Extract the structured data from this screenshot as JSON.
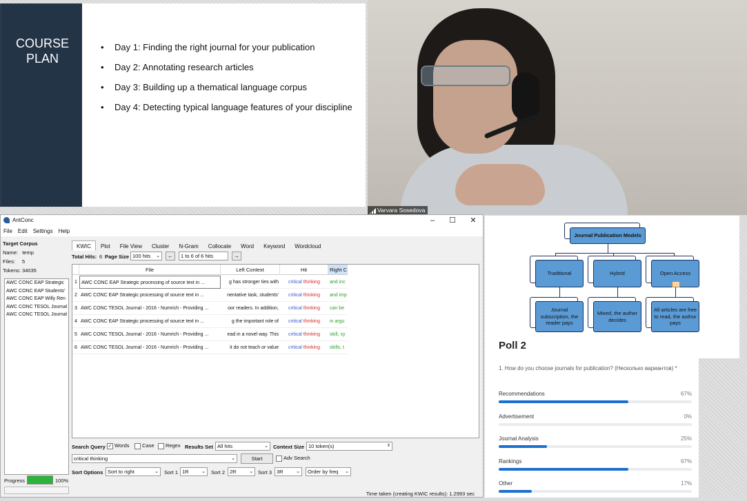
{
  "slide": {
    "title_line1": "COURSE",
    "title_line2": "PLAN",
    "items": [
      "Day 1: Finding the right journal for your publication",
      "Day 2: Annotating research articles",
      "Day 3: Building up a thematical language corpus",
      "Day 4: Detecting typical language features of your discipline"
    ]
  },
  "webcam": {
    "participant_name": "Varvara Sosedova"
  },
  "antconc": {
    "title": "AntConc",
    "window_controls": {
      "minimize": "–",
      "maximize": "☐",
      "close": "✕"
    },
    "menu": [
      "File",
      "Edit",
      "Settings",
      "Help"
    ],
    "target_corpus_label": "Target Corpus",
    "name_label": "Name:",
    "name_value": "temp",
    "files_label": "Files:",
    "files_value": "5",
    "tokens_label": "Tokens:",
    "tokens_value": "34035",
    "corpus_files": [
      "AWC CONC EAP Strategic",
      "AWC CONC EAP Students'",
      "AWC CONC EAP Willy Ren",
      "AWC CONC TESOL Journal",
      "AWC CONC TESOL Journal"
    ],
    "progress_label": "Progress",
    "progress_value": "100%",
    "tabs": [
      "KWIC",
      "Plot",
      "File View",
      "Cluster",
      "N-Gram",
      "Collocate",
      "Word",
      "Keyword",
      "Wordcloud"
    ],
    "total_hits_label": "Total Hits:",
    "total_hits_value": "6",
    "page_size_label": "Page Size",
    "page_size_value": "100 hits",
    "page_range": "1 to 6 of 6 hits",
    "columns": {
      "file": "File",
      "left": "Left Context",
      "hit": "Hit",
      "right": "Right Context"
    },
    "rows": [
      {
        "n": "1",
        "file": "AWC CONC EAP Strategic processing of source text in ...",
        "left": "g has stronger ties with",
        "hit1": "critical",
        "hit2": "thinking",
        "right": "and inc"
      },
      {
        "n": "2",
        "file": "AWC CONC EAP Strategic processing of source text in ...",
        "left": "nentative task, students'",
        "hit1": "critical",
        "hit2": "thinking",
        "right": "and imp"
      },
      {
        "n": "3",
        "file": "AWC CONC TESOL Journal - 2016 - Numrich - Providing ...",
        "left": "oor readers. In addition,",
        "hit1": "critical",
        "hit2": "thinking",
        "right": "can be"
      },
      {
        "n": "4",
        "file": "AWC CONC EAP Strategic processing of source text in ...",
        "left": "g the important role of",
        "hit1": "critical",
        "hit2": "thinking",
        "right": "in argu"
      },
      {
        "n": "5",
        "file": "AWC CONC TESOL Journal - 2016 - Numrich - Providing ...",
        "left": "ead in a novel way. This",
        "hit1": "critical",
        "hit2": "thinking",
        "right": "skill, sy"
      },
      {
        "n": "6",
        "file": "AWC CONC TESOL Journal - 2016 - Numrich - Providing ...",
        "left": "it do not teach or value",
        "hit1": "critical",
        "hit2": "thinking",
        "right": "skills, t"
      }
    ],
    "search_query_label": "Search Query",
    "words_label": "Words",
    "case_label": "Case",
    "regex_label": "Regex",
    "results_set_label": "Results Set",
    "results_set_value": "All hits",
    "context_size_label": "Context Size",
    "context_size_value": "10 token(s)",
    "search_value": "critical thinking",
    "start_label": "Start",
    "adv_search_label": "Adv Search",
    "sort_options_label": "Sort Options",
    "sort_value": "Sort to right",
    "sort1_label": "Sort 1",
    "sort1_value": "1R",
    "sort2_label": "Sort 2",
    "sort2_value": "2R",
    "sort3_label": "Sort 3",
    "sort3_value": "3R",
    "order_value": "Order by freq",
    "status": "Time taken (creating KWIC results):  1.2993 sec"
  },
  "diagram": {
    "root": "Journal Publication Models",
    "branches": [
      {
        "title": "Traditional",
        "detail": "Journal subscription, the reader pays"
      },
      {
        "title": "Hybrid",
        "detail": "Mixed, the author decides"
      },
      {
        "title": "Open Access",
        "detail": "All articles are free to read, the author pays"
      }
    ]
  },
  "poll": {
    "title": "Poll 2",
    "question": "1. How do you choose journals for publication? (Несколько вариантов) *",
    "options": [
      {
        "label": "Recommendations",
        "percent": 67
      },
      {
        "label": "Advertisement",
        "percent": 0
      },
      {
        "label": "Journal Analysis",
        "percent": 25
      },
      {
        "label": "Rankings",
        "percent": 67
      },
      {
        "label": "Other",
        "percent": 17
      }
    ]
  },
  "colors": {
    "slide_sidebar": "#243447",
    "poll_bar": "#1c6fd1",
    "hit_left": "#3a5bd0",
    "hit_right": "#d03030",
    "context_right": "#2aa02a",
    "diagram_box": "#5b9bd5"
  }
}
